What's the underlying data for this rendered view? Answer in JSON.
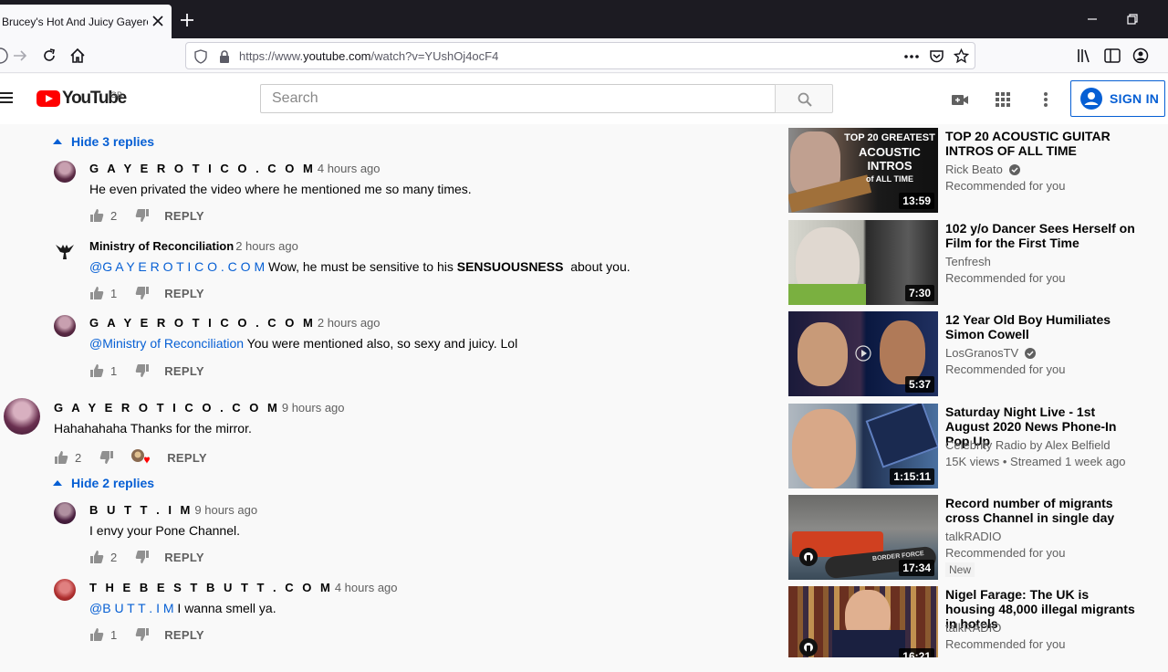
{
  "browser": {
    "tab_title": "Brucey's Hot And Juicy Gayerot",
    "url_prefix": "https://www.",
    "url_domain": "youtube.com",
    "url_path": "/watch?v=YUshOj4ocF4"
  },
  "header": {
    "logo_text": "YouTube",
    "region": "GB",
    "search_placeholder": "Search",
    "signin_label": "SIGN IN"
  },
  "comments": {
    "thread1_toggle": "Hide 3 replies",
    "thread2_toggle": "Hide 2 replies",
    "items": [
      {
        "author": "G A Y E R O T I C O . C O M",
        "time": "4 hours ago",
        "text": "He even privated the video where he mentioned me so many times.",
        "likes": "2",
        "reply": "REPLY"
      },
      {
        "author": "Ministry of Reconciliation",
        "time": "2 hours ago",
        "mention": "@G A Y E R O T I C O . C O M",
        "text": " Wow, he must be sensitive to his ",
        "emphasis": "SENSUOUSNESS",
        "text_after": "  about you.",
        "likes": "1",
        "reply": "REPLY"
      },
      {
        "author": "G A Y E R O T I C O . C O M",
        "time": "2 hours ago",
        "mention": "@Ministry of Reconciliation",
        "text": " You were mentioned also, so sexy and juicy. Lol",
        "likes": "1",
        "reply": "REPLY"
      },
      {
        "author": "G A Y E R O T I C O . C O M",
        "time": "9 hours ago",
        "text": "Hahahahaha Thanks for the mirror.",
        "likes": "2",
        "reply": "REPLY"
      },
      {
        "author": "B U T T . I M",
        "time": "9 hours ago",
        "text": "I envy your Pone Channel.",
        "likes": "2",
        "reply": "REPLY"
      },
      {
        "author": "T H E B E S T B U T T . C O M",
        "time": "4 hours ago",
        "mention": "@B U T T . I M",
        "text": " I wanna smell ya.",
        "likes": "1",
        "reply": "REPLY"
      }
    ]
  },
  "sidebar": {
    "videos": [
      {
        "title": "TOP 20 ACOUSTIC GUITAR INTROS OF ALL TIME",
        "channel": "Rick Beato",
        "verified": true,
        "meta": "Recommended for you",
        "duration": "13:59",
        "thumb_text1": "TOP 20 GREATEST",
        "thumb_text2": "ACOUSTIC INTROS",
        "thumb_text3": "of ALL TIME"
      },
      {
        "title": "102 y/o Dancer Sees Herself on Film for the First Time",
        "channel": "Tenfresh",
        "meta": "Recommended for you",
        "duration": "7:30"
      },
      {
        "title": "12 Year Old Boy Humiliates Simon Cowell",
        "channel": "LosGranosTV",
        "verified": true,
        "meta": "Recommended for you",
        "duration": "5:37"
      },
      {
        "title": "Saturday Night Live - 1st August 2020 News Phone-In Pop Up",
        "channel": "Celebrity Radio by Alex Belfield",
        "meta": "15K views • Streamed 1 week ago",
        "duration": "1:15:11"
      },
      {
        "title": "Record number of migrants cross Channel in single day",
        "channel": "talkRADIO",
        "meta": "Recommended for you",
        "badge": "New",
        "duration": "17:34",
        "thumb_text": "BORDER FORCE"
      },
      {
        "title": "Nigel Farage: The UK is housing 48,000 illegal migrants in hotels",
        "channel": "talkRADIO",
        "meta": "Recommended for you",
        "duration": "16:21"
      }
    ]
  },
  "colors": {
    "link_blue": "#065fd4",
    "yt_red": "#ff0000",
    "text_secondary": "#606060"
  }
}
